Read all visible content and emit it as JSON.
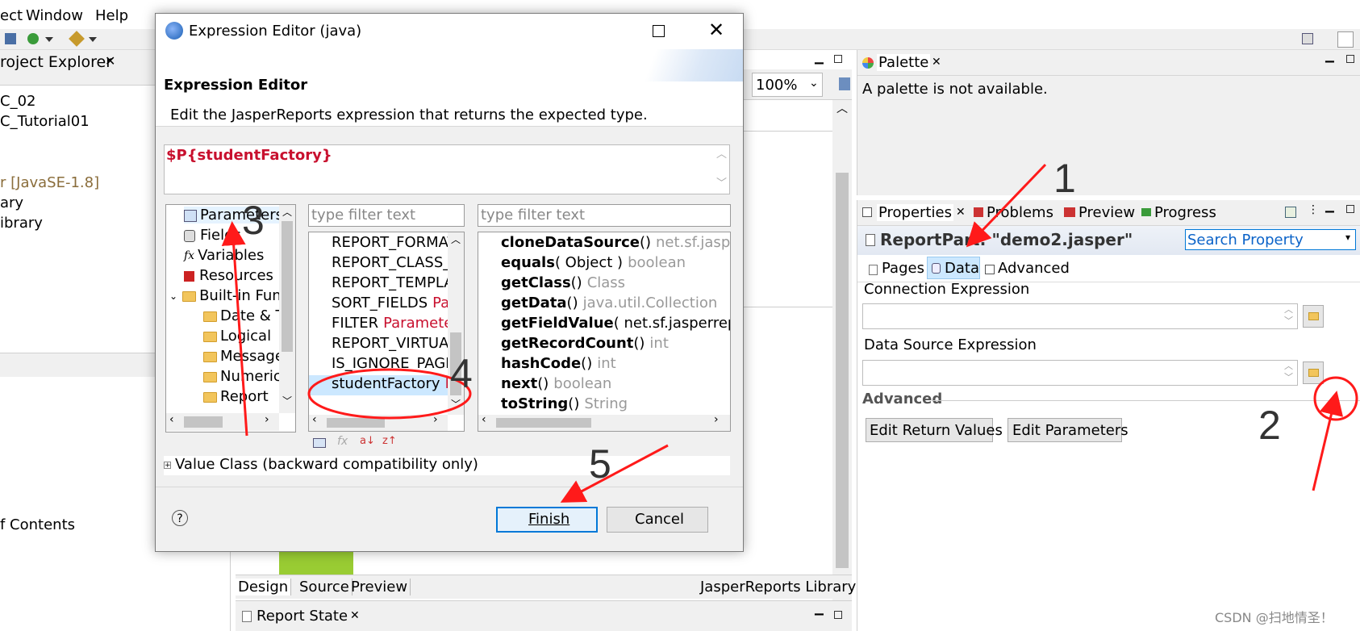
{
  "menu": {
    "items": [
      "ect",
      "Window",
      "Help"
    ]
  },
  "left_panel": {
    "tab": "roject Explorer",
    "tree": [
      "C_02",
      "C_Tutorial01",
      "r [JavaSE-1.8]",
      "ary",
      "ibrary"
    ],
    "toc": "f Contents"
  },
  "editor": {
    "zoom": "100%",
    "bottom_tabs": [
      "Design",
      "Source",
      "Preview"
    ],
    "library": "JasperReports Library",
    "report_state_tab": "Report State"
  },
  "dialog": {
    "title": "Expression Editor (java)",
    "heading": "Expression Editor",
    "description": "Edit the JasperReports expression that returns the expected type.",
    "expression": "$P{studentFactory}",
    "categories": [
      "Parameters",
      "Fields",
      "Variables",
      "Resources",
      "Built-in Fun",
      "Date & T",
      "Logical",
      "Message",
      "Numeric",
      "Report"
    ],
    "filter_placeholder_1": "type filter text",
    "filter_placeholder_2": "type filter text",
    "params": [
      {
        "name": "REPORT_FORMAT",
        "type": ""
      },
      {
        "name": "REPORT_CLASS_LO",
        "type": ""
      },
      {
        "name": "REPORT_TEMPLAT",
        "type": ""
      },
      {
        "name": "SORT_FIELDS",
        "type": "Para"
      },
      {
        "name": "FILTER",
        "type": "Parameter"
      },
      {
        "name": "REPORT_VIRTUAL",
        "type": ""
      },
      {
        "name": "IS_IGNORE_PAGIN",
        "type": ""
      },
      {
        "name": "studentFactory",
        "type": "Pa"
      }
    ],
    "methods": [
      {
        "name": "cloneDataSource",
        "args": "()",
        "ret": "net.sf.jasperre"
      },
      {
        "name": "equals",
        "args": "( Object )",
        "ret": "boolean"
      },
      {
        "name": "getClass",
        "args": "()",
        "ret": "Class"
      },
      {
        "name": "getData",
        "args": "()",
        "ret": "java.util.Collection"
      },
      {
        "name": "getFieldValue",
        "args": "( net.sf.jasperreport",
        "ret": ""
      },
      {
        "name": "getRecordCount",
        "args": "()",
        "ret": "int"
      },
      {
        "name": "hashCode",
        "args": "()",
        "ret": "int"
      },
      {
        "name": "next",
        "args": "()",
        "ret": "boolean"
      },
      {
        "name": "toString",
        "args": "()",
        "ret": "String"
      }
    ],
    "value_class": "Value Class (backward compatibility only)",
    "finish": "Finish",
    "cancel": "Cancel",
    "help": "?"
  },
  "palette": {
    "tab": "Palette",
    "message": "A palette is not available."
  },
  "properties": {
    "tabs": [
      "Properties",
      "Problems",
      "Preview",
      "Progress"
    ],
    "title": "ReportPart: \"demo2.jasper\"",
    "search_placeholder": "Search Property",
    "subtabs": [
      "Pages",
      "Data",
      "Advanced"
    ],
    "connection_label": "Connection Expression",
    "datasource_label": "Data Source Expression",
    "advanced_section": "Advanced",
    "edit_return": "Edit Return Values",
    "edit_params": "Edit Parameters"
  },
  "annotations": [
    "1",
    "2",
    "3",
    "4",
    "5"
  ],
  "watermark": "CSDN @扫地情圣！",
  "colors": {
    "accent": "#0078d7",
    "annotation": "#ff1a1a",
    "expression": "#c8102e",
    "selection": "#cce8ff",
    "design_block": "#99cc33"
  }
}
